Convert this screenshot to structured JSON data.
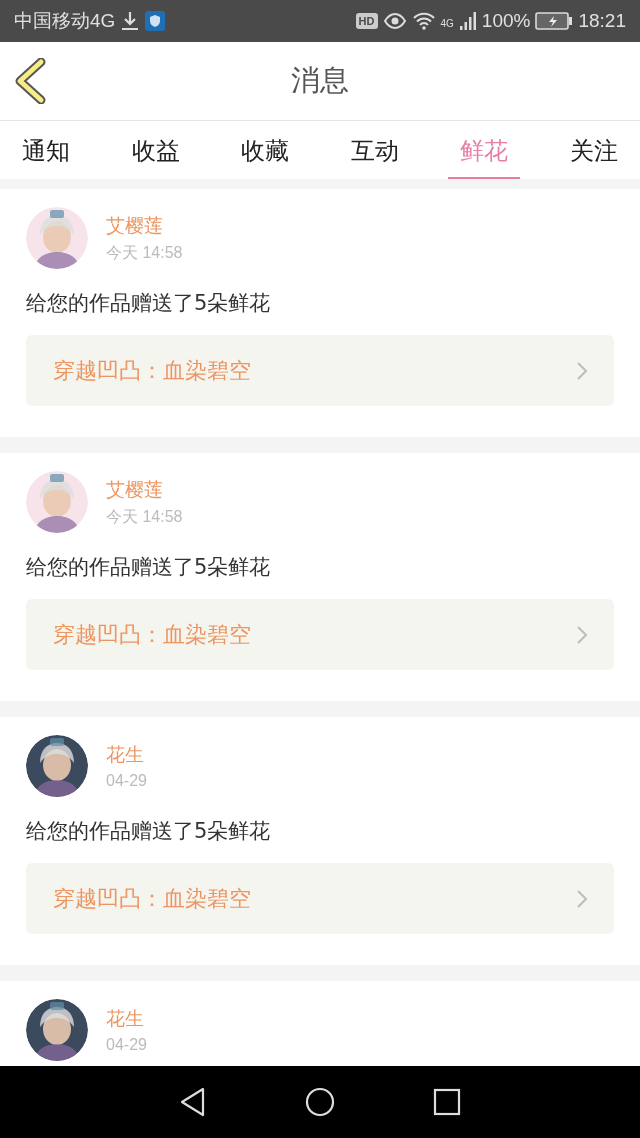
{
  "status_bar": {
    "carrier": "中国移动4G",
    "hd_badge": "HD",
    "network": "4G",
    "battery": "100%",
    "time": "18:21"
  },
  "header": {
    "title": "消息"
  },
  "tabs": [
    {
      "label": "通知",
      "selected": false
    },
    {
      "label": "收益",
      "selected": false
    },
    {
      "label": "收藏",
      "selected": false
    },
    {
      "label": "互动",
      "selected": false
    },
    {
      "label": "鲜花",
      "selected": true
    },
    {
      "label": "关注",
      "selected": false
    }
  ],
  "messages": [
    {
      "author": "艾樱莲",
      "time": "今天 14:58",
      "text": "给您的作品赠送了5朵鲜花",
      "work": "穿越凹凸：血染碧空"
    },
    {
      "author": "艾樱莲",
      "time": "今天 14:58",
      "text": "给您的作品赠送了5朵鲜花",
      "work": "穿越凹凸：血染碧空"
    },
    {
      "author": "花生",
      "time": "04-29",
      "text": "给您的作品赠送了5朵鲜花",
      "work": "穿越凹凸：血染碧空"
    },
    {
      "author": "花生",
      "time": "04-29"
    }
  ]
}
